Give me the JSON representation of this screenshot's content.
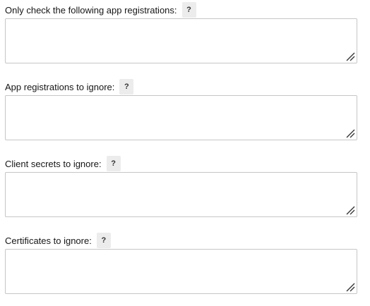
{
  "fields": [
    {
      "label": "Only check the following app registrations:",
      "help": "?",
      "value": ""
    },
    {
      "label": "App registrations to ignore:",
      "help": "?",
      "value": ""
    },
    {
      "label": "Client secrets to ignore:",
      "help": "?",
      "value": ""
    },
    {
      "label": "Certificates to ignore:",
      "help": "?",
      "value": ""
    }
  ]
}
